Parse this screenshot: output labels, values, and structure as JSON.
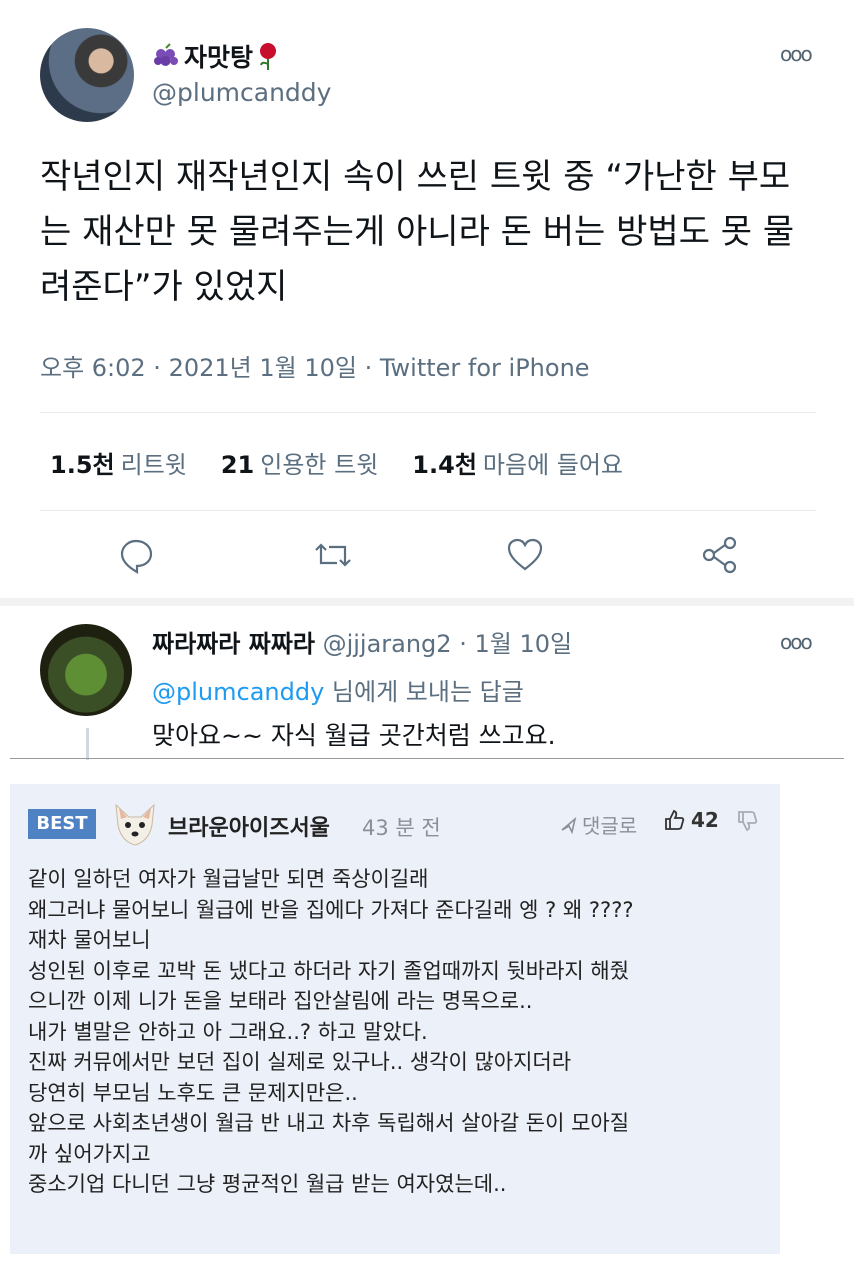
{
  "tweet": {
    "display_name": "자맛탕",
    "handle": "@plumcanddy",
    "more_label": "ooo",
    "text": "작년인지 재작년인지 속이 쓰린 트윗 중 “가난한 부모는 재산만 못 물려주는게 아니라 돈 버는 방법도 못 물려준다”가 있었지",
    "meta": "오후 6:02 · 2021년 1월 10일 · Twitter for iPhone",
    "stats": [
      {
        "count": "1.5천",
        "label": "리트윗"
      },
      {
        "count": "21",
        "label": "인용한 트윗"
      },
      {
        "count": "1.4천",
        "label": "마음에 들어요"
      }
    ],
    "icons": [
      "reply-icon",
      "retweet-icon",
      "like-icon",
      "share-icon"
    ]
  },
  "reply": {
    "display_name": "짜라짜라 짜짜라",
    "handle": "@jjjarang2",
    "date": "· 1월 10일",
    "more_label": "ooo",
    "to_link": "@plumcanddy",
    "to_suffix": " 님에게 보내는 답글",
    "text": "맞아요~~ 자식 월급 곳간처럼 쓰고요."
  },
  "comment": {
    "badge": "BEST",
    "user": "브라운아이즈서울",
    "time": "43 분 전",
    "reply_label": "댓글로",
    "likes": "42",
    "body": "같이 일하던 여자가 월급날만 되면 죽상이길래\n왜그러냐 물어보니 월급에 반을 집에다 가져다 준다길래 엥 ? 왜 ????\n재차 물어보니\n성인된 이후로 꼬박 돈 냈다고 하더라 자기 졸업때까지 뒷바라지 해줬\n으니깐 이제 니가 돈을 보태라 집안살림에 라는 명목으로..\n내가 별말은 안하고 아 그래요..? 하고 말았다.\n진짜 커뮤에서만 보던 집이 실제로 있구나.. 생각이 많아지더라\n당연히 부모님 노후도 큰 문제지만은..\n앞으로 사회초년생이 월급 반 내고 차후 독립해서 살아갈 돈이 모아질\n까 싶어가지고\n중소기업 다니던 그냥 평균적인 월급 받는 여자였는데.."
  }
}
